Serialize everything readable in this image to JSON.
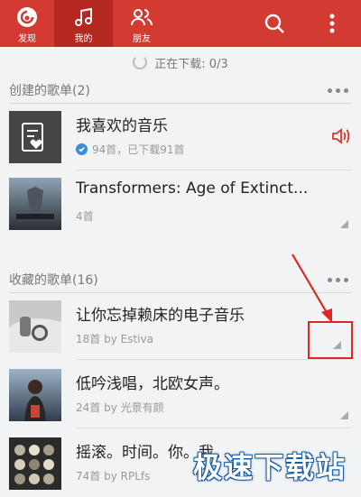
{
  "tabs": [
    {
      "label": "发现",
      "icon": "netease-music-logo-icon"
    },
    {
      "label": "我的",
      "icon": "music-note-icon"
    },
    {
      "label": "朋友",
      "icon": "friends-icon"
    }
  ],
  "status_text": "正在下载: 0/3",
  "created_section": {
    "title": "创建的歌单(2)"
  },
  "created_playlists": [
    {
      "title": "我喜欢的音乐",
      "subtitle": "94首，已下载91首"
    },
    {
      "title": "Transformers: Age of Extinct...",
      "subtitle": "4首"
    }
  ],
  "collected_section": {
    "title": "收藏的歌单(16)"
  },
  "collected_playlists": [
    {
      "title": "让你忘掉赖床的电子音乐",
      "subtitle": "18首 by Estiva"
    },
    {
      "title": "低吟浅唱，北欧女声。",
      "subtitle": "24首 by 光景有颜"
    },
    {
      "title": "摇滚。时间。你。我。",
      "subtitle": "74首 by RPLfs"
    }
  ],
  "watermark": "极速下载站",
  "colors": {
    "accent": "#d33a31",
    "annotation": "#e32521"
  }
}
